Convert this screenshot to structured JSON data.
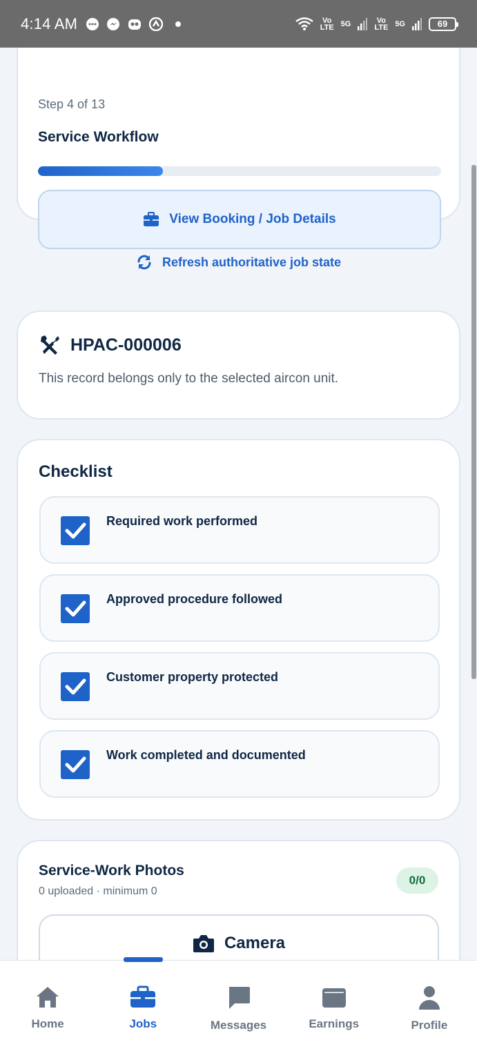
{
  "status_bar": {
    "time": "4:14 AM",
    "net1_top": "Vo",
    "net1_bottom": "LTE",
    "net2": "5G",
    "net3_top": "Vo",
    "net3_bottom": "LTE",
    "net4": "5G",
    "battery": "69"
  },
  "workflow": {
    "step_text": "Step 4 of 13",
    "title": "Service Workflow",
    "progress_fraction": 0.31,
    "booking_button_label": "View Booking / Job Details"
  },
  "refresh_link_label": "Refresh authoritative job state",
  "record": {
    "title": "HPAC-000006",
    "description": "This record belongs only to the selected aircon unit."
  },
  "checklist": {
    "title": "Checklist",
    "items": [
      {
        "label": "Required work performed",
        "checked": true
      },
      {
        "label": "Approved procedure followed",
        "checked": true
      },
      {
        "label": "Customer property protected",
        "checked": true
      },
      {
        "label": "Work completed and documented",
        "checked": true
      }
    ]
  },
  "photos": {
    "title": "Service-Work Photos",
    "subtitle": "0 uploaded · minimum 0",
    "badge": "0/0",
    "camera_label": "Camera"
  },
  "bottom_nav": {
    "items": [
      {
        "label": "Home",
        "icon": "home-icon"
      },
      {
        "label": "Jobs",
        "icon": "briefcase-icon",
        "active": true
      },
      {
        "label": "Messages",
        "icon": "chat-icon"
      },
      {
        "label": "Earnings",
        "icon": "wallet-icon"
      },
      {
        "label": "Profile",
        "icon": "person-icon"
      }
    ]
  },
  "colors": {
    "accent": "#1f63c9",
    "text": "#0f2744",
    "badge_bg": "#ddf3e6",
    "badge_text": "#166c3b"
  }
}
